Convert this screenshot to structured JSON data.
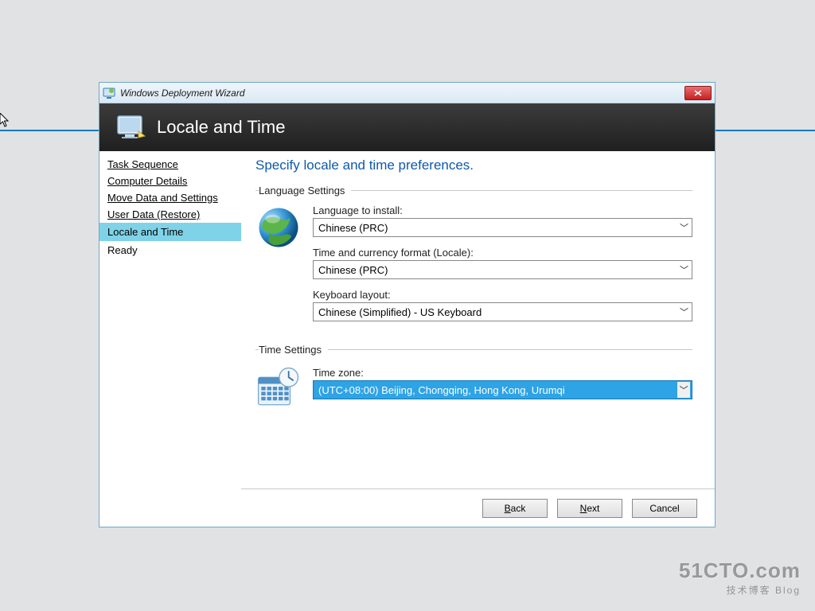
{
  "window": {
    "title": "Windows Deployment Wizard",
    "banner_title": "Locale and Time"
  },
  "sidebar": {
    "items": [
      {
        "label": "Task Sequence",
        "type": "link"
      },
      {
        "label": "Computer Details",
        "type": "link"
      },
      {
        "label": "Move Data and Settings",
        "type": "link"
      },
      {
        "label": "User Data (Restore)",
        "type": "link"
      },
      {
        "label": "Locale and Time",
        "type": "active"
      },
      {
        "label": "Ready",
        "type": "item"
      }
    ]
  },
  "main": {
    "heading": "Specify locale and time preferences.",
    "group_language_legend": "Language Settings",
    "group_time_legend": "Time Settings",
    "fields": {
      "language_label": "Language to install:",
      "language_value": "Chinese (PRC)",
      "locale_label": "Time and currency format (Locale):",
      "locale_value": "Chinese (PRC)",
      "keyboard_label": "Keyboard layout:",
      "keyboard_value": "Chinese (Simplified) - US Keyboard",
      "timezone_label": "Time zone:",
      "timezone_value": "(UTC+08:00) Beijing, Chongqing, Hong Kong, Urumqi"
    }
  },
  "footer": {
    "back": "Back",
    "next": "Next",
    "cancel": "Cancel"
  },
  "watermark": {
    "line1": "51CTO.com",
    "line2": "技术博客  Blog"
  }
}
